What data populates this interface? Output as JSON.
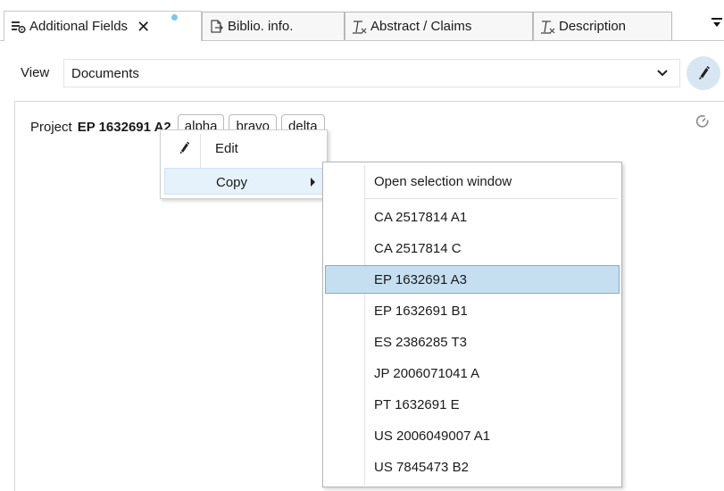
{
  "tabs": [
    {
      "label": "Additional Fields",
      "icon": "fields-icon",
      "active": true,
      "closable": true,
      "close_label": "✕"
    },
    {
      "label": "Biblio. info.",
      "icon": "biblio-icon",
      "active": false
    },
    {
      "label": "Abstract / Claims",
      "icon": "clear-format-icon",
      "active": false
    },
    {
      "label": "Description",
      "icon": "clear-format-icon",
      "active": false
    }
  ],
  "view": {
    "label": "View",
    "selected": "Documents"
  },
  "project": {
    "label": "Project",
    "number": "EP 1632691 A2",
    "tags": [
      "alpha",
      "bravo",
      "delta"
    ]
  },
  "context_menu": {
    "items": [
      {
        "label": "Edit",
        "icon": "pencil-icon"
      },
      {
        "label": "Copy",
        "has_submenu": true
      }
    ]
  },
  "submenu": {
    "header": "Open selection window",
    "items": [
      "CA 2517814 A1",
      "CA 2517814 C",
      "EP 1632691 A3",
      "EP 1632691 B1",
      "ES 2386285 T3",
      "JP 2006071041 A",
      "PT 1632691 E",
      "US 2006049007 A1",
      "US 7845473 B2"
    ],
    "selected_index": 2
  },
  "colors": {
    "selection_fill": "#c5dff0",
    "selection_border": "#7aaed6",
    "hover_fill": "#e5f1fb",
    "edit_button_bg": "#d8e6f3",
    "dot": "#7ec4f0"
  }
}
